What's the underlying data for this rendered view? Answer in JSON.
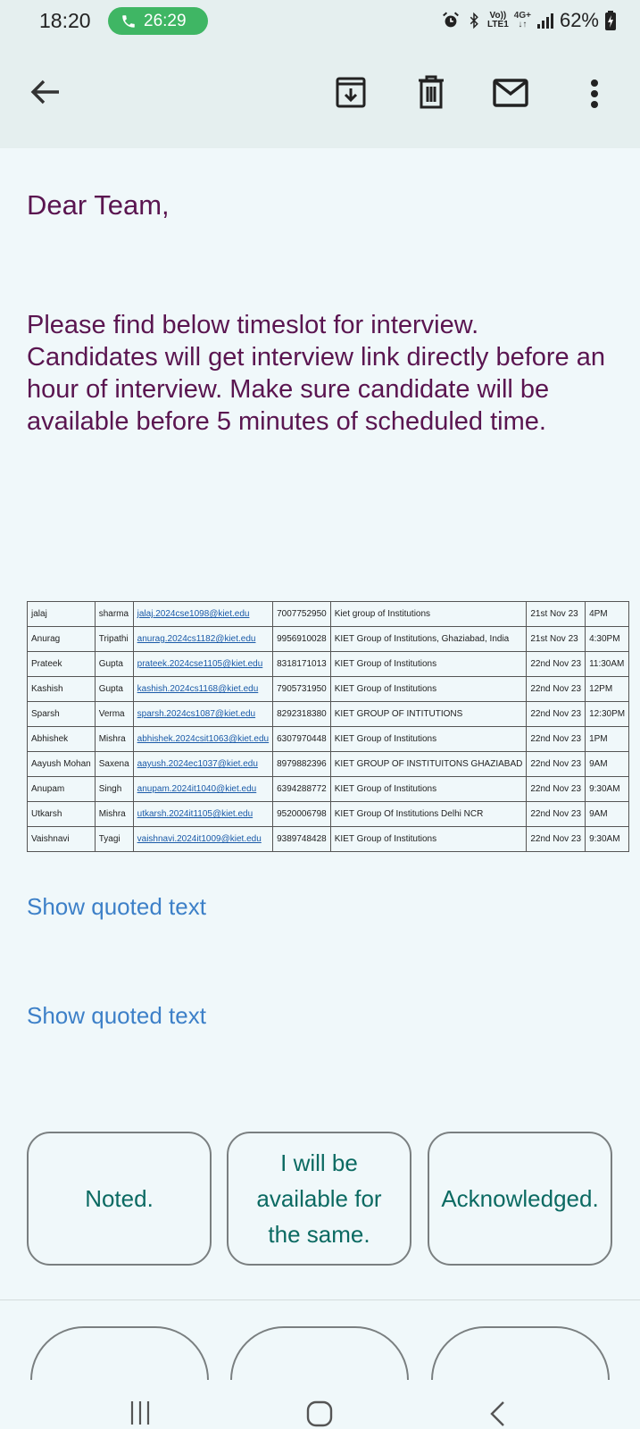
{
  "status": {
    "time": "18:20",
    "call_duration": "26:29",
    "volte": "Vo))",
    "lte": "LTE1",
    "network": "4G+",
    "battery": "62%"
  },
  "toolbar": {
    "back": "arrow-back-icon",
    "archive": "archive-icon",
    "delete": "delete-icon",
    "mark_unread": "mail-icon",
    "more": "more-vert-icon"
  },
  "email": {
    "greeting": "Dear Team,",
    "message": "Please find below timeslot for interview. Candidates will get interview link directly before an hour of interview. Make sure candidate will be available before 5 minutes of scheduled time."
  },
  "schedule": {
    "rows": [
      {
        "first": "jalaj",
        "last": "sharma",
        "email": "jalaj.2024cse1098@kiet.edu",
        "phone": "7007752950",
        "college": "Kiet group of Institutions",
        "date": "21st Nov 23",
        "time": "4PM"
      },
      {
        "first": "Anurag",
        "last": "Tripathi",
        "email": "anurag.2024cs1182@kiet.edu",
        "phone": "9956910028",
        "college": "KIET Group of Institutions, Ghaziabad, India",
        "date": "21st Nov 23",
        "time": "4:30PM"
      },
      {
        "first": "Prateek",
        "last": "Gupta",
        "email": "prateek.2024cse1105@kiet.edu",
        "phone": "8318171013",
        "college": "KIET Group of Institutions",
        "date": "22nd Nov 23",
        "time": "11:30AM"
      },
      {
        "first": "Kashish",
        "last": "Gupta",
        "email": "kashish.2024cs1168@kiet.edu",
        "phone": "7905731950",
        "college": "KIET Group of Institutions",
        "date": "22nd Nov 23",
        "time": "12PM"
      },
      {
        "first": "Sparsh",
        "last": "Verma",
        "email": "sparsh.2024cs1087@kiet.edu",
        "phone": "8292318380",
        "college": "KIET GROUP OF INTITUTIONS",
        "date": "22nd Nov 23",
        "time": "12:30PM"
      },
      {
        "first": "Abhishek",
        "last": "Mishra",
        "email": "abhishek.2024csit1063@kiet.edu",
        "phone": "6307970448",
        "college": "KIET Group of Institutions",
        "date": "22nd Nov 23",
        "time": "1PM"
      },
      {
        "first": "Aayush Mohan",
        "last": "Saxena",
        "email": "aayush.2024ec1037@kiet.edu",
        "phone": "8979882396",
        "college": "KIET GROUP OF INSTITUITONS GHAZIABAD",
        "date": "22nd Nov 23",
        "time": "9AM"
      },
      {
        "first": "Anupam",
        "last": "Singh",
        "email": "anupam.2024it1040@kiet.edu",
        "phone": "6394288772",
        "college": "KIET Group of Institutions",
        "date": "22nd Nov 23",
        "time": "9:30AM"
      },
      {
        "first": "Utkarsh",
        "last": "Mishra",
        "email": "utkarsh.2024it1105@kiet.edu",
        "phone": "9520006798",
        "college": "KIET Group Of Institutions Delhi NCR",
        "date": "22nd Nov 23",
        "time": "9AM"
      },
      {
        "first": "Vaishnavi",
        "last": "Tyagi",
        "email": "vaishnavi.2024it1009@kiet.edu",
        "phone": "9389748428",
        "college": "KIET Group of Institutions",
        "date": "22nd Nov 23",
        "time": "9:30AM"
      }
    ]
  },
  "quoted": {
    "first": "Show quoted text",
    "second": "Show quoted text"
  },
  "smart_replies": [
    "Noted.",
    "I will be available for the same.",
    "Acknowledged."
  ],
  "nav": {
    "recents": "recents-icon",
    "home": "home-icon",
    "back": "nav-back-icon"
  }
}
